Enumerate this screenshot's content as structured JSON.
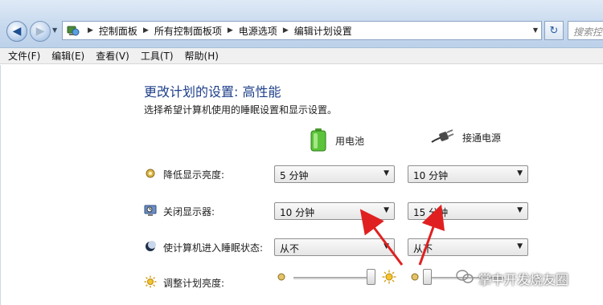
{
  "navigation": {
    "breadcrumbs": [
      "控制面板",
      "所有控制面板项",
      "电源选项",
      "编辑计划设置"
    ],
    "search_placeholder": "搜索控制"
  },
  "menu": [
    "文件(F)",
    "编辑(E)",
    "查看(V)",
    "工具(T)",
    "帮助(H)"
  ],
  "page": {
    "title": "更改计划的设置: 高性能",
    "subtitle": "选择希望计算机使用的睡眠设置和显示设置。"
  },
  "columns": {
    "battery": "用电池",
    "plugged_in": "接通电源"
  },
  "settings": [
    {
      "label": "降低显示亮度:",
      "battery": "5 分钟",
      "plugged_in": "10 分钟",
      "icon": "dim-display-icon"
    },
    {
      "label": "关闭显示器:",
      "battery": "10 分钟",
      "plugged_in": "15 分钟",
      "icon": "display-off-icon"
    },
    {
      "label": "使计算机进入睡眠状态:",
      "battery": "从不",
      "plugged_in": "从不",
      "icon": "sleep-icon"
    }
  ],
  "brightness": {
    "label": "调整计划亮度:",
    "battery_level": 1.0,
    "plugged_in_level": 0.0
  },
  "watermark": "掌中开发烧友圈",
  "colors": {
    "title": "#1e3f8a",
    "annotation_arrow": "#e02020"
  }
}
